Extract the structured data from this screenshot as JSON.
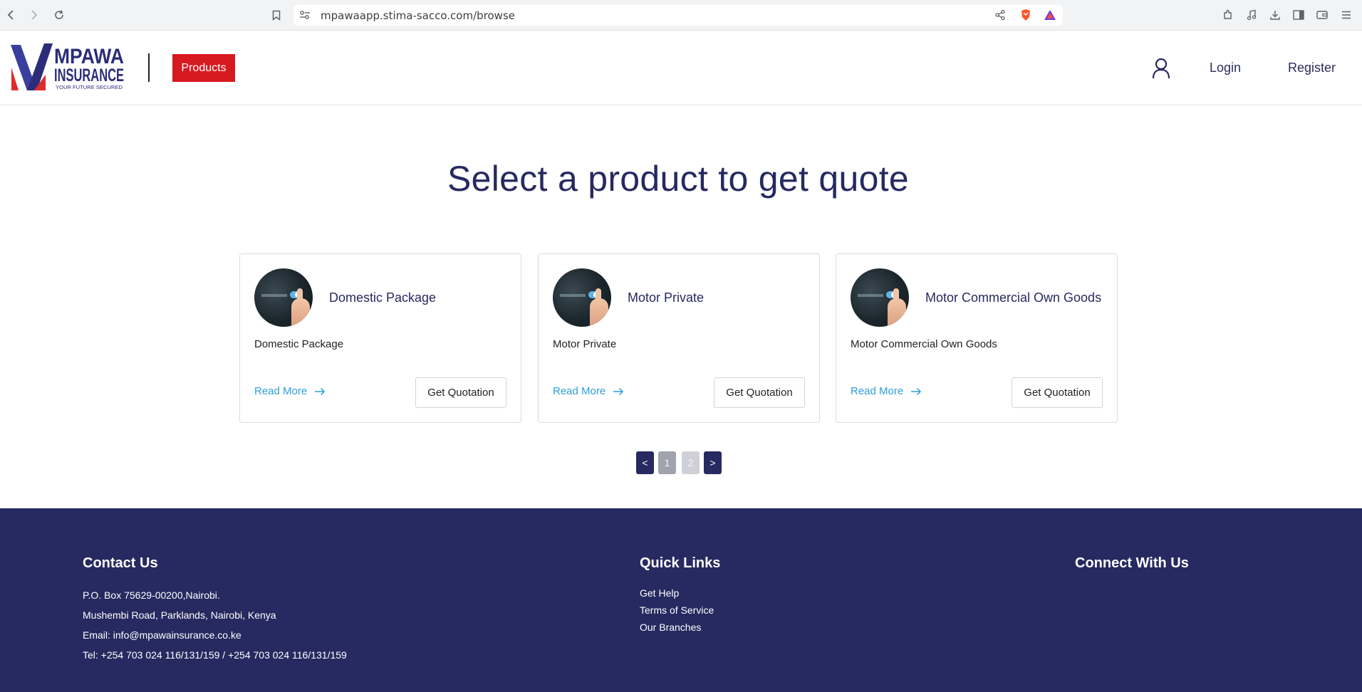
{
  "browser": {
    "url": "mpawaapp.stima-sacco.com/browse"
  },
  "header": {
    "logo": {
      "brand_line1": "MPAWA",
      "brand_line2": "INSURANCE",
      "tagline": "YOUR FUTURE SECURED",
      "colors": {
        "navy": "#2b2d7a",
        "red": "#e02b2b"
      }
    },
    "products_label": "Products",
    "login_label": "Login",
    "register_label": "Register"
  },
  "main": {
    "title": "Select a product to get quote",
    "cards": [
      {
        "title": "Domestic Package",
        "description": "Domestic Package",
        "read_more": "Read More",
        "quote_label": "Get Quotation"
      },
      {
        "title": "Motor Private",
        "description": "Motor Private",
        "read_more": "Read More",
        "quote_label": "Get Quotation"
      },
      {
        "title": "Motor Commercial Own Goods",
        "description": "Motor Commercial Own Goods",
        "read_more": "Read More",
        "quote_label": "Get Quotation"
      }
    ],
    "pagination": {
      "prev": "<",
      "pages": [
        "1",
        "2"
      ],
      "next": ">"
    }
  },
  "footer": {
    "contact": {
      "heading": "Contact Us",
      "lines": [
        "P.O. Box 75629-00200,Nairobi.",
        "Mushembi Road, Parklands, Nairobi, Kenya",
        "Email: info@mpawainsurance.co.ke",
        "Tel: +254 703 024 116/131/159 / +254 703 024 116/131/159"
      ]
    },
    "quick_links": {
      "heading": "Quick Links",
      "items": [
        "Get Help",
        "Terms of Service",
        "Our Branches"
      ]
    },
    "connect": {
      "heading": "Connect With Us"
    }
  },
  "colors": {
    "primary_navy": "#262a60",
    "accent_red": "#d71920",
    "link_blue": "#2d9fd8"
  }
}
